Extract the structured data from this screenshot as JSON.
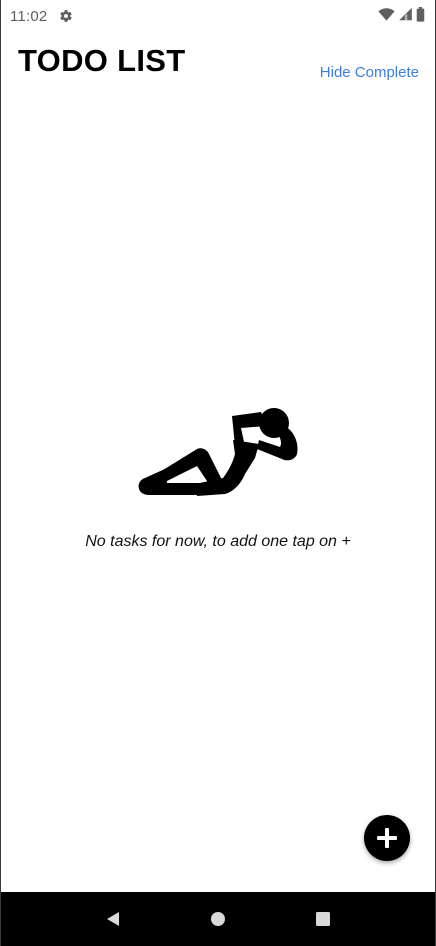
{
  "status_bar": {
    "time": "11:02",
    "icons": [
      "gear-icon",
      "wifi-icon",
      "signal-icon",
      "battery-icon"
    ]
  },
  "header": {
    "title": "TODO LIST",
    "hide_complete_label": "Hide Complete"
  },
  "empty_state": {
    "illustration": "relaxing-person-icon",
    "message": "No tasks for now, to add one tap on +"
  },
  "fab": {
    "icon": "plus-icon"
  },
  "nav_bar": {
    "icons": [
      "back-icon",
      "home-icon",
      "recents-icon"
    ]
  },
  "colors": {
    "accent": "#3b7ddd",
    "status_text": "#5f5f5f",
    "fab_bg": "#000000",
    "nav_bg": "#000000"
  }
}
